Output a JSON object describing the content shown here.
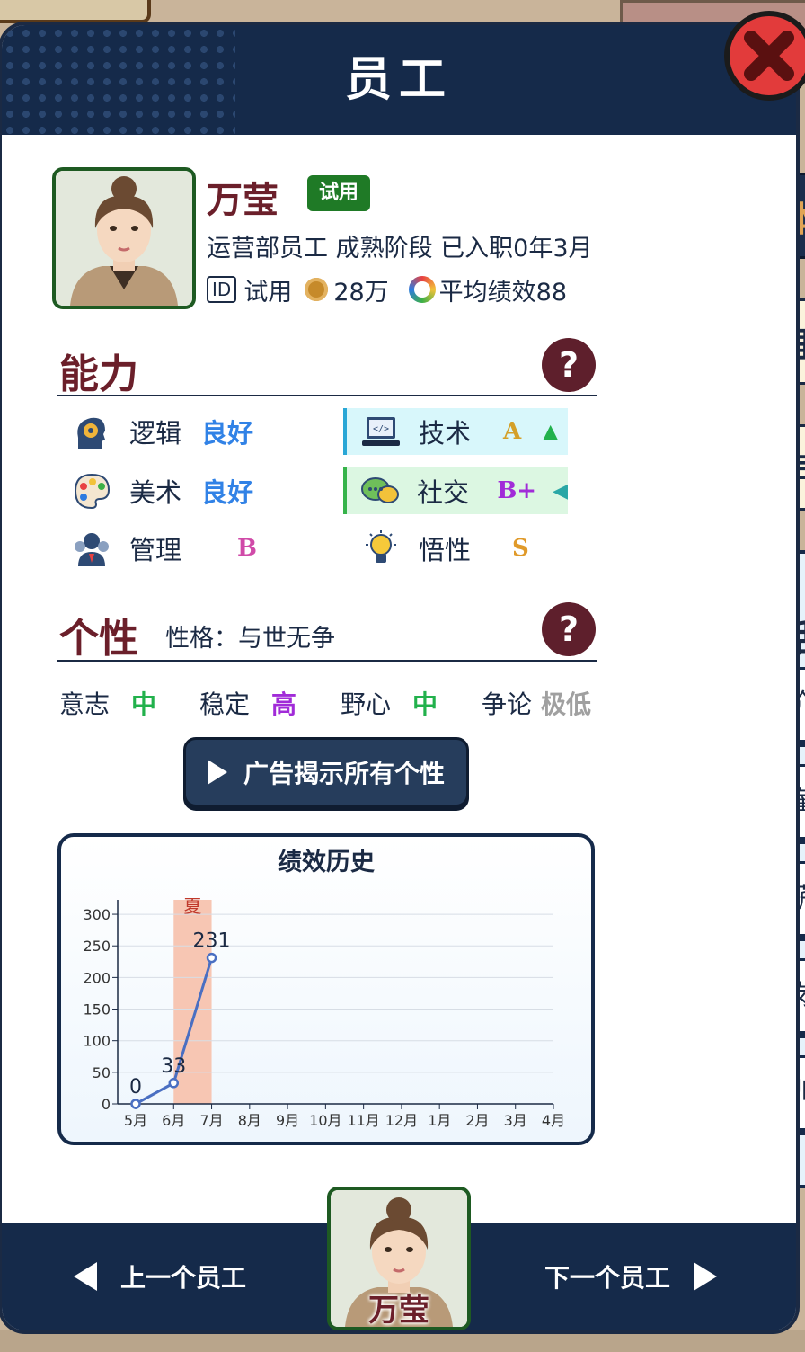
{
  "header": {
    "title": "员工"
  },
  "employee": {
    "name": "万莹",
    "status_badge": "试用",
    "role_line": "运营部员工 成熟阶段 已入职0年3月",
    "id_tag": "ID",
    "id_status": "试用",
    "salary": "28万",
    "avg_performance": "平均绩效88"
  },
  "abilities": {
    "title": "能力",
    "help": "?",
    "items": [
      {
        "label": "逻辑",
        "value": "良好",
        "icon": "gear-head-icon"
      },
      {
        "label": "技术",
        "value": "A",
        "trend": "▲",
        "icon": "laptop-icon"
      },
      {
        "label": "美术",
        "value": "良好",
        "icon": "palette-icon"
      },
      {
        "label": "社交",
        "value": "B+",
        "trend": "◀",
        "icon": "chat-bubbles-icon"
      },
      {
        "label": "管理",
        "value": "B",
        "icon": "team-icon"
      },
      {
        "label": "悟性",
        "value": "S",
        "icon": "lightbulb-icon"
      }
    ]
  },
  "personality": {
    "title": "个性",
    "subtitle": "性格：与世无争",
    "help": "?",
    "traits": [
      {
        "label": "意志",
        "value": "中"
      },
      {
        "label": "稳定",
        "value": "高"
      },
      {
        "label": "野心",
        "value": "中"
      },
      {
        "label": "争论",
        "value": "极低"
      }
    ],
    "ad_button": "广告揭示所有个性"
  },
  "side_tabs": {
    "basic": "基本",
    "mind": "心理",
    "contract": "合同"
  },
  "talk": {
    "title": "谈话",
    "buttons": [
      "评价",
      "解雇",
      "调薪",
      "转岗",
      "培训"
    ]
  },
  "navigation": {
    "prev": "上一个员工",
    "next": "下一个员工"
  },
  "colors": {
    "navy": "#152a4a",
    "maroon": "#6b1f2a",
    "good_blue": "#3182e6",
    "trait_green": "#22b14c",
    "trait_purple": "#a12bd8",
    "trait_gray": "#a0a0a0"
  },
  "chart_data": {
    "type": "line",
    "title": "绩效历史",
    "categories": [
      "5月",
      "6月",
      "7月",
      "8月",
      "9月",
      "10月",
      "11月",
      "12月",
      "1月",
      "2月",
      "3月",
      "4月"
    ],
    "series": [
      {
        "values": [
          0,
          33,
          231
        ]
      }
    ],
    "data_labels": [
      "0",
      "33",
      "231"
    ],
    "yticks": [
      0,
      50,
      100,
      150,
      200,
      250,
      300
    ],
    "ylim": [
      0,
      320
    ],
    "highlight_band": {
      "category": "6月",
      "label": "夏"
    },
    "grid": true
  }
}
